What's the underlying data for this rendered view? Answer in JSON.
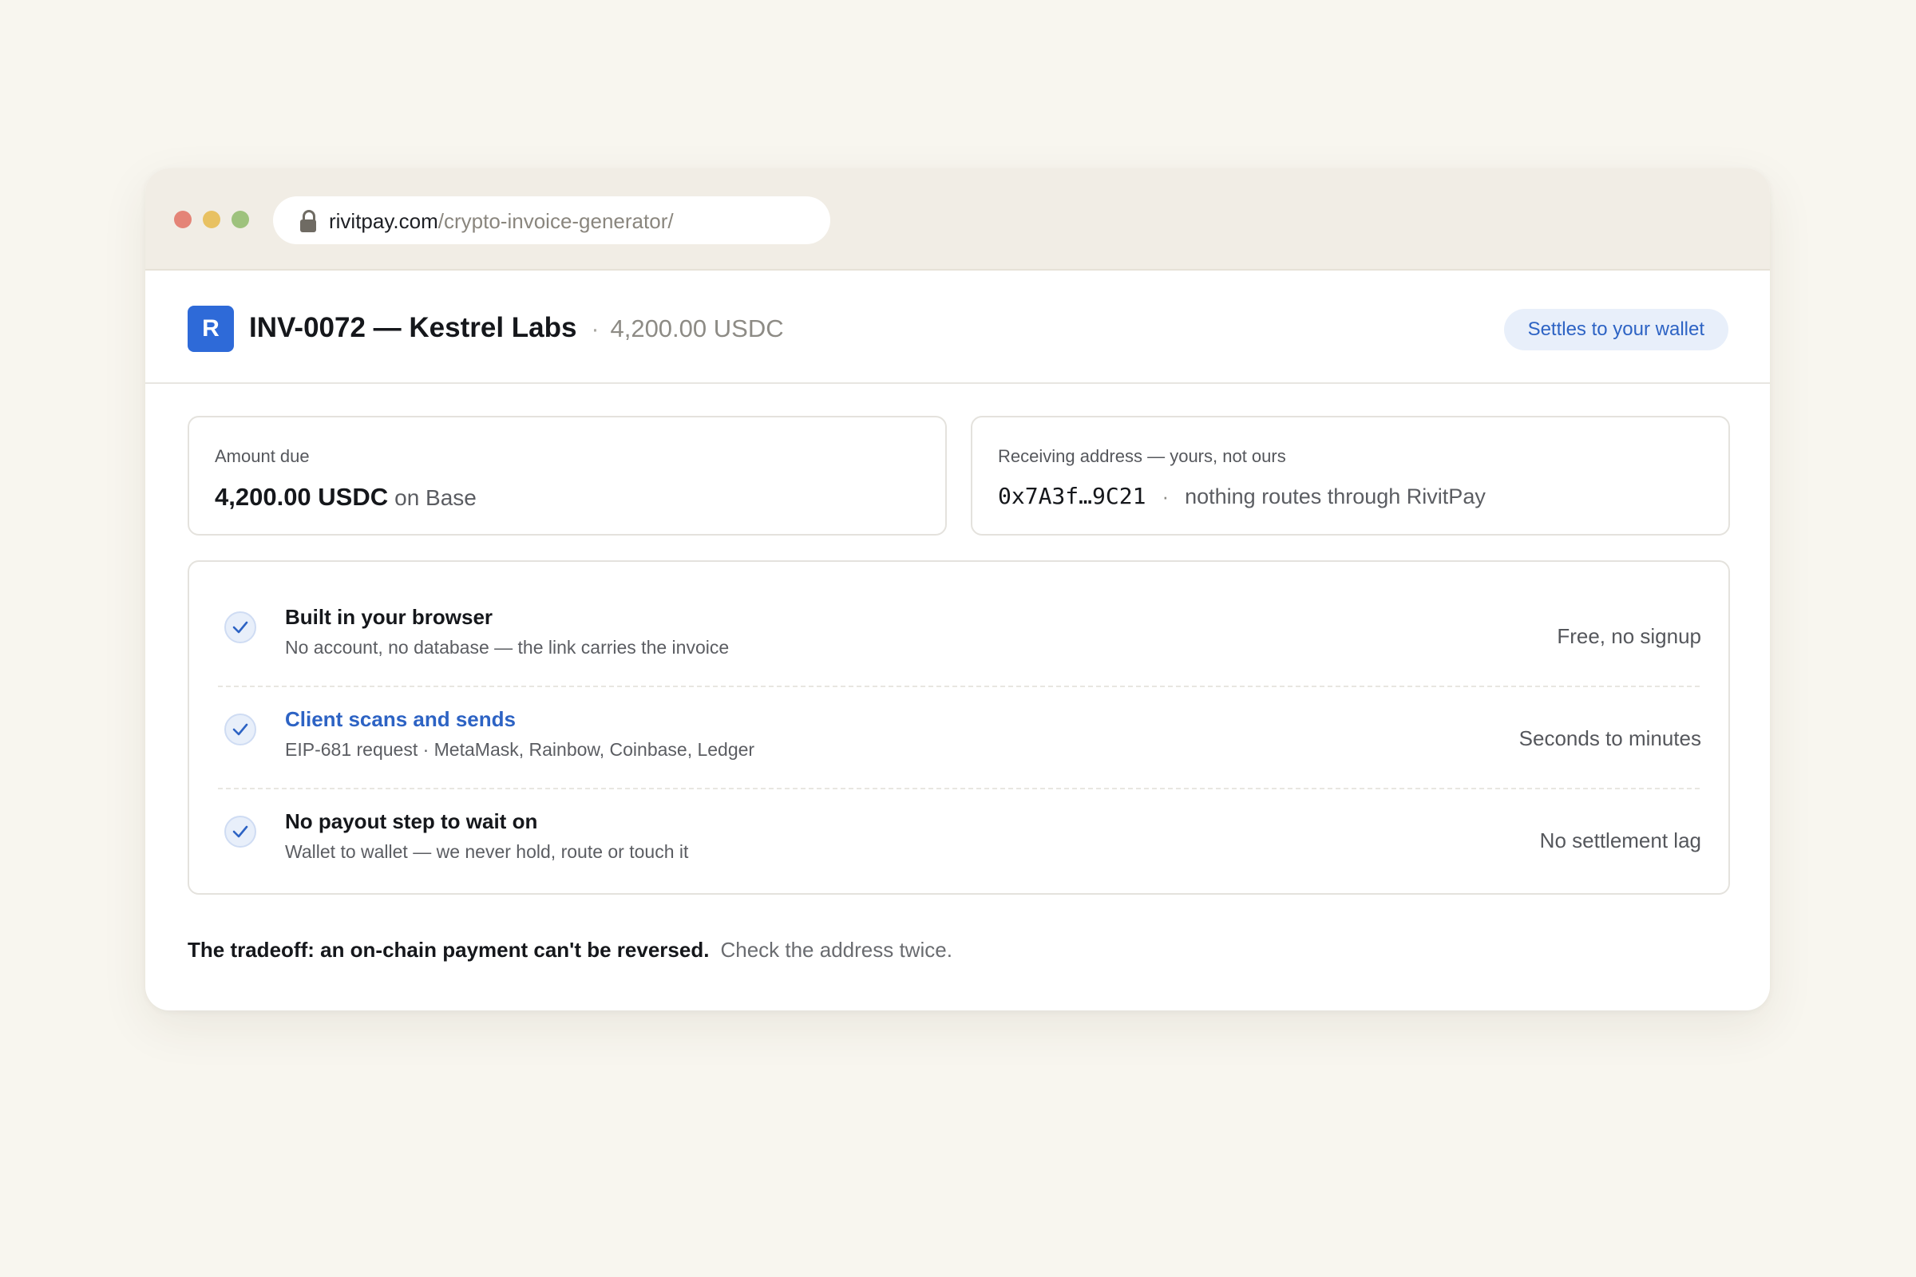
{
  "browser": {
    "url_domain": "rivitpay.com",
    "url_path": "/crypto-invoice-generator/",
    "lock_icon": "lock-icon",
    "traffic_lights": [
      "#e48477",
      "#e8c162",
      "#9ec27d"
    ]
  },
  "header": {
    "logo_letter": "R",
    "title": "INV-0072 — Kestrel Labs",
    "separator": "·",
    "amount": "4,200.00 USDC",
    "badge": "Settles to your wallet"
  },
  "amount_card": {
    "label": "Amount due",
    "value": "4,200.00 USDC",
    "network": "on Base"
  },
  "address_card": {
    "label": "Receiving address — yours, not ours",
    "address": "0x7A3f…9C21",
    "separator": "·",
    "note": "nothing routes through RivitPay"
  },
  "features": [
    {
      "title": "Built in your browser",
      "subtitle": "No account, no database — the link carries the invoice",
      "right": "Free, no signup",
      "icon": "check-icon"
    },
    {
      "title": "Client scans and sends",
      "subtitle": "EIP-681 request · MetaMask, Rainbow, Coinbase, Ledger",
      "right": "Seconds to minutes",
      "icon": "check-icon"
    },
    {
      "title": "No payout step to wait on",
      "subtitle": "Wallet to wallet — we never hold, route or touch it",
      "right": "No settlement lag",
      "icon": "check-icon"
    }
  ],
  "footer": {
    "bold": "The tradeoff: an on-chain payment can't be reversed.",
    "normal": "Check the address twice."
  },
  "colors": {
    "accent": "#2e6ad8",
    "link": "#2d63c4",
    "background": "#f8f6ef"
  }
}
